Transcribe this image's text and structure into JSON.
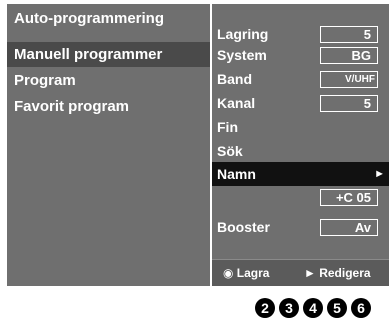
{
  "left_menu": {
    "items": [
      {
        "label": "Auto-programmering"
      },
      {
        "label": "Manuell programmer"
      },
      {
        "label": "Program"
      },
      {
        "label": "Favorit program"
      }
    ]
  },
  "right_menu": {
    "rows": [
      {
        "label": "Lagring",
        "value": "5"
      },
      {
        "label": "System",
        "value": "BG"
      },
      {
        "label": "Band",
        "value": "V/UHF"
      },
      {
        "label": "Kanal",
        "value": "5"
      },
      {
        "label": "Fin"
      },
      {
        "label": "Sök"
      },
      {
        "label": "Namn",
        "arrow": "►"
      },
      {
        "value": "+C 05"
      },
      {
        "label": "Booster",
        "value": "Av"
      }
    ]
  },
  "footer": {
    "save": "◉ Lagra",
    "edit": "► Redigera"
  },
  "step_badges": [
    "2",
    "3",
    "4",
    "5",
    "6"
  ]
}
